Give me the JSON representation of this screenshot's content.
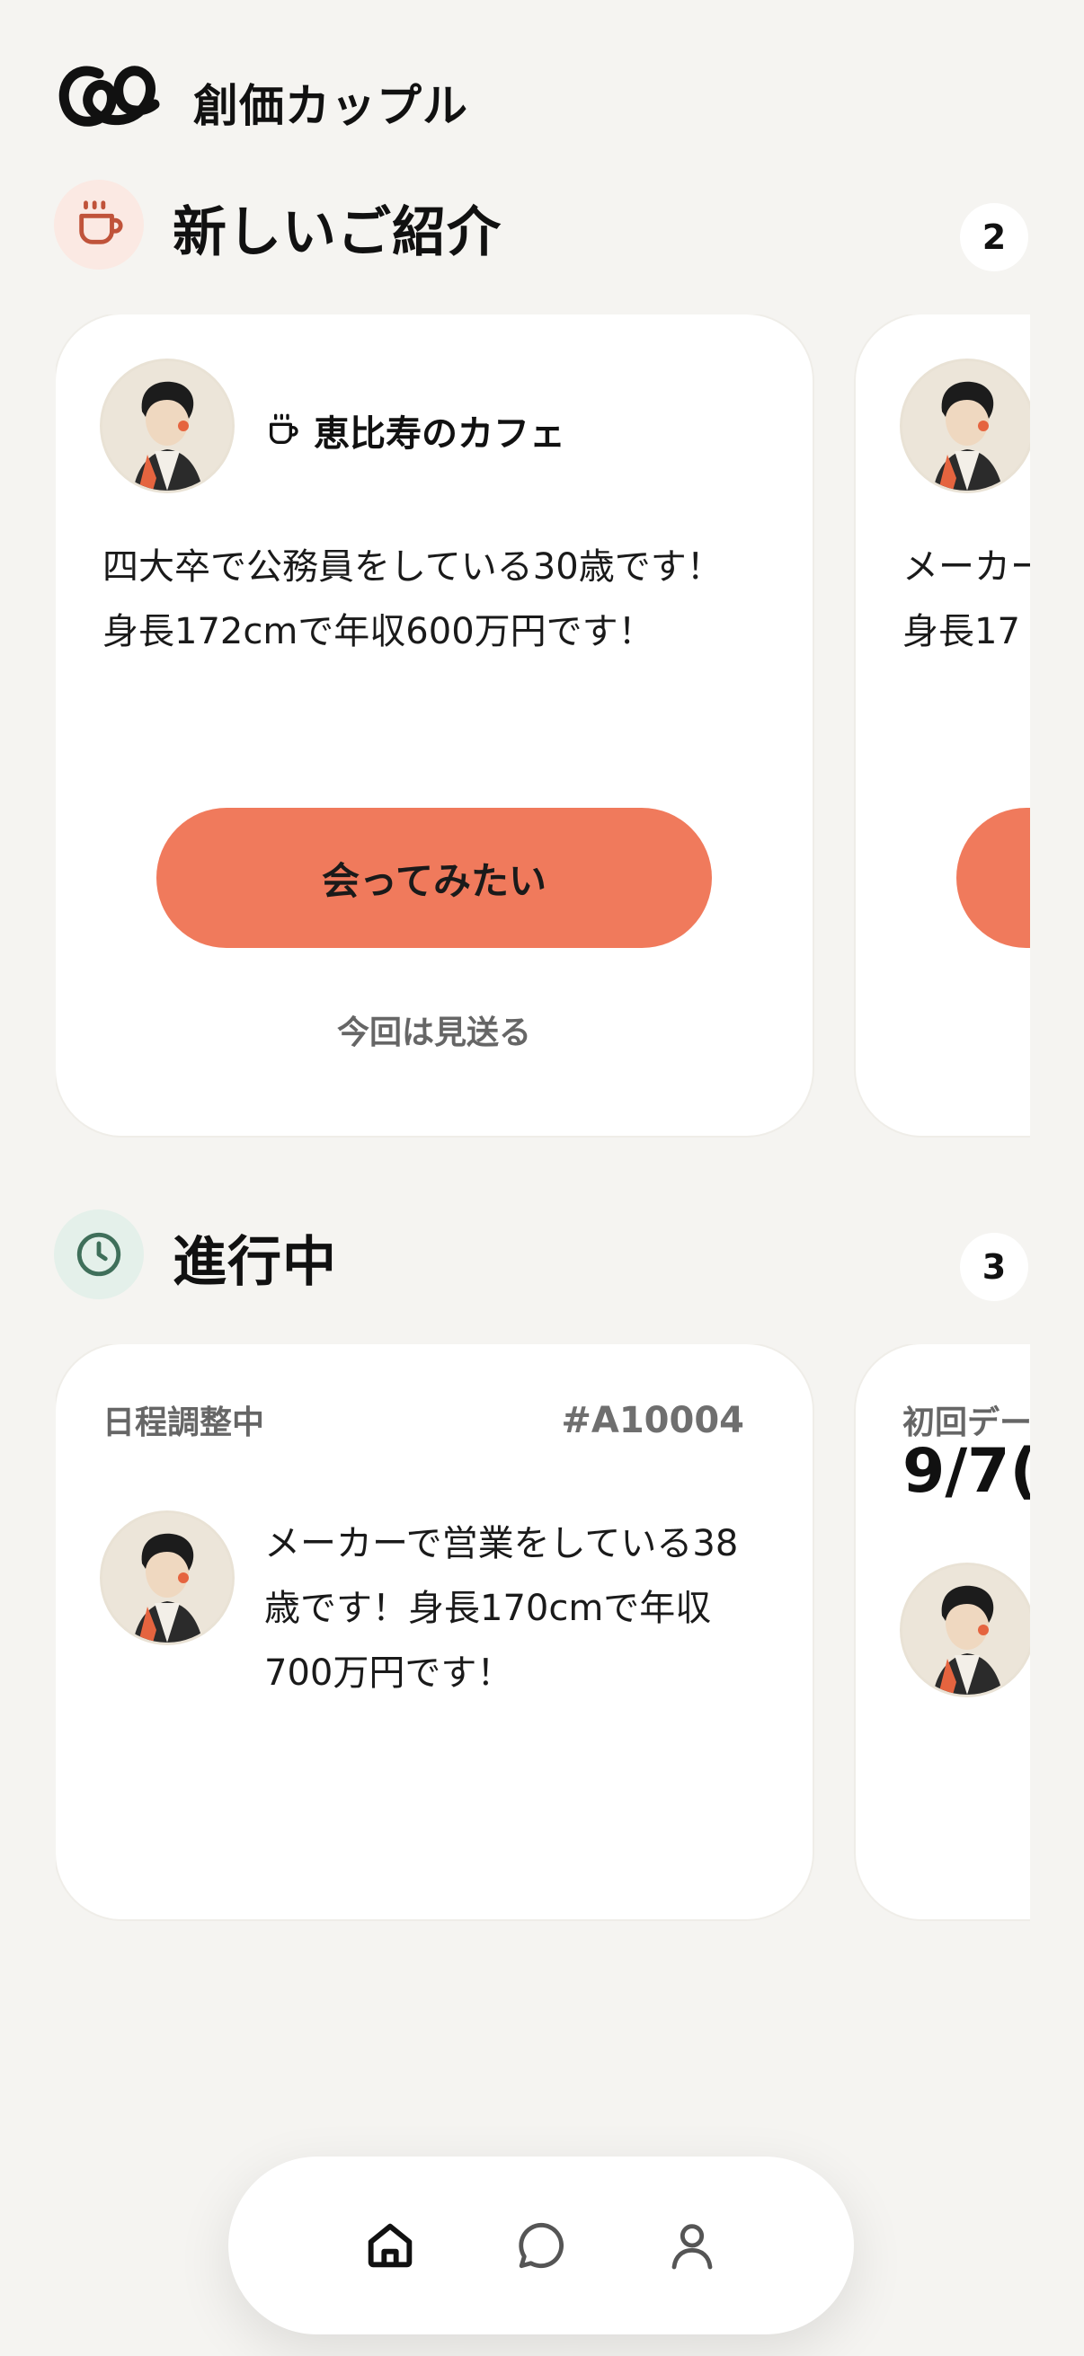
{
  "app": {
    "title": "創価カップル"
  },
  "introductions": {
    "title": "新しいご紹介",
    "count": "2",
    "cards": [
      {
        "location": "恵比寿のカフェ",
        "bio_line1": "四大卒で公務員をしている30歳です！",
        "bio_line2": "身長172cmで年収600万円です！",
        "accept_label": "会ってみたい",
        "skip_label": "今回は見送る"
      },
      {
        "bio_line1": "メーカー",
        "bio_line2": "身長17"
      }
    ]
  },
  "in_progress": {
    "title": "進行中",
    "count": "3",
    "cards": [
      {
        "status": "日程調整中",
        "ref": "#A10004",
        "bio_line1": "メーカーで営業をしている38",
        "bio_line2": "歳です！身長170cmで年収",
        "bio_line3": "700万円です！"
      },
      {
        "status": "初回デー",
        "date": "9/7("
      }
    ]
  },
  "nav": [
    "home-icon",
    "chat-icon",
    "profile-icon"
  ],
  "colors": {
    "accent": "#f07a5c",
    "background": "#f5f4f1",
    "intro_icon_bg": "#fbe9e3",
    "progress_icon_bg": "#e4f0ea",
    "progress_icon": "#3f6f5a",
    "intro_icon": "#c0533a"
  }
}
